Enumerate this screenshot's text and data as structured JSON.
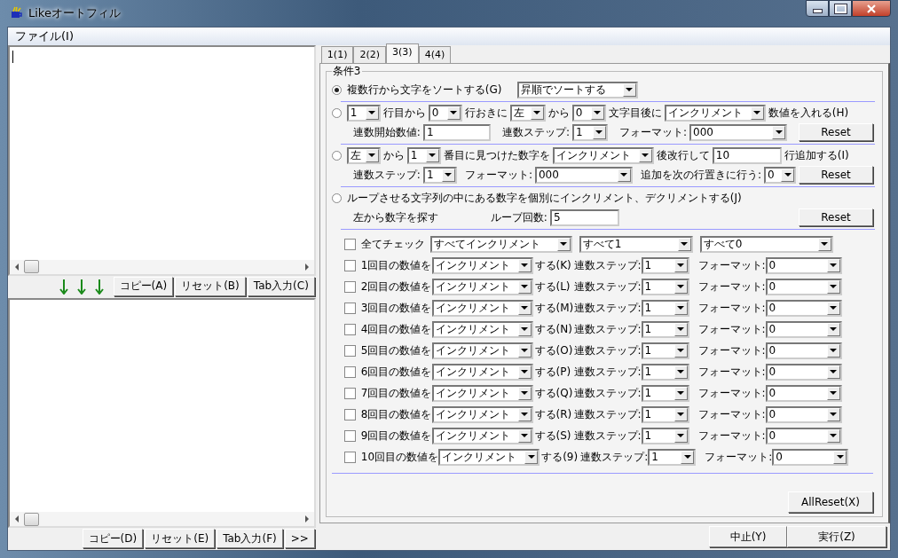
{
  "window": {
    "title": "Likeオートフィル"
  },
  "menu": [
    "ファイル(I)"
  ],
  "left": {
    "top_buttons": [
      "コピー(A)",
      "リセット(B)",
      "Tab入力(C)"
    ],
    "bottom_buttons": [
      "コピー(D)",
      "リセット(E)",
      "Tab入力(F)",
      ">>"
    ]
  },
  "tabs": [
    {
      "label": "1(1)",
      "selected": false
    },
    {
      "label": "2(2)",
      "selected": false
    },
    {
      "label": "3(3)",
      "selected": true
    },
    {
      "label": "4(4)",
      "selected": false
    }
  ],
  "group": {
    "title": "条件3",
    "options": [
      {
        "selected": true,
        "lines": [
          [
            {
              "kind": "label",
              "text": "複数行から文字をソートする(G)"
            },
            {
              "kind": "dropdown",
              "value": "昇順でソートする"
            }
          ]
        ]
      },
      {
        "selected": false,
        "lines": [
          [
            {
              "kind": "dropdown",
              "value": "1"
            },
            {
              "kind": "label",
              "text": "行目から"
            },
            {
              "kind": "dropdown",
              "value": "0"
            },
            {
              "kind": "label",
              "text": "行おきに"
            },
            {
              "kind": "dropdown",
              "value": "左"
            },
            {
              "kind": "label",
              "text": "から"
            },
            {
              "kind": "dropdown",
              "value": "0"
            },
            {
              "kind": "label",
              "text": "文字目後に"
            },
            {
              "kind": "dropdown",
              "value": "インクリメント"
            },
            {
              "kind": "label",
              "text": "数値を入れる(H)"
            }
          ],
          [
            {
              "kind": "label",
              "text": "連数開始数値:"
            },
            {
              "kind": "input",
              "value": "1"
            },
            {
              "kind": "label",
              "text": "連数ステップ:"
            },
            {
              "kind": "dropdown",
              "value": "1"
            },
            {
              "kind": "label",
              "text": "フォーマット:"
            },
            {
              "kind": "dropdown",
              "value": "000"
            },
            {
              "kind": "button",
              "text": "Reset"
            }
          ]
        ]
      },
      {
        "selected": false,
        "lines": [
          [
            {
              "kind": "dropdown",
              "value": "左"
            },
            {
              "kind": "label",
              "text": "から"
            },
            {
              "kind": "dropdown",
              "value": "1"
            },
            {
              "kind": "label",
              "text": "番目に見つけた数字を"
            },
            {
              "kind": "dropdown",
              "value": "インクリメント"
            },
            {
              "kind": "label",
              "text": "後改行して"
            },
            {
              "kind": "input",
              "value": "10"
            },
            {
              "kind": "label",
              "text": "行追加する(I)"
            }
          ],
          [
            {
              "kind": "label",
              "text": "連数ステップ:"
            },
            {
              "kind": "dropdown",
              "value": "1"
            },
            {
              "kind": "label",
              "text": "フォーマット:"
            },
            {
              "kind": "dropdown",
              "value": "000"
            },
            {
              "kind": "label",
              "text": "追加を次の行置きに行う:"
            },
            {
              "kind": "dropdown",
              "value": "0"
            },
            {
              "kind": "button",
              "text": "Reset"
            }
          ]
        ]
      },
      {
        "selected": false,
        "lines": [
          [
            {
              "kind": "label",
              "text": "ループさせる文字列の中にある数字を個別にインクリメント、デクリメントする(J)"
            }
          ],
          [
            {
              "kind": "label",
              "text": "左から数字を探す"
            },
            {
              "kind": "label",
              "text": "ループ回数:"
            },
            {
              "kind": "input",
              "value": "5"
            },
            {
              "kind": "button",
              "text": "Reset"
            }
          ]
        ]
      }
    ],
    "all_check": {
      "checked": false,
      "label": "全てチェック",
      "dropdowns": [
        "すべてインクリメント",
        "すべて1",
        "すべて0"
      ]
    },
    "rows": [
      {
        "checked": false,
        "label": "1回目の数値を",
        "mode": "インクリメント",
        "suffix": "する(K)",
        "step_label": "連数ステップ:",
        "step": "1",
        "format_label": "フォーマット:",
        "format": "0"
      },
      {
        "checked": false,
        "label": "2回目の数値を",
        "mode": "インクリメント",
        "suffix": "する(L)",
        "step_label": "連数ステップ:",
        "step": "1",
        "format_label": "フォーマット:",
        "format": "0"
      },
      {
        "checked": false,
        "label": "3回目の数値を",
        "mode": "インクリメント",
        "suffix": "する(M)",
        "step_label": "連数ステップ:",
        "step": "1",
        "format_label": "フォーマット:",
        "format": "0"
      },
      {
        "checked": false,
        "label": "4回目の数値を",
        "mode": "インクリメント",
        "suffix": "する(N)",
        "step_label": "連数ステップ:",
        "step": "1",
        "format_label": "フォーマット:",
        "format": "0"
      },
      {
        "checked": false,
        "label": "5回目の数値を",
        "mode": "インクリメント",
        "suffix": "する(O)",
        "step_label": "連数ステップ:",
        "step": "1",
        "format_label": "フォーマット:",
        "format": "0"
      },
      {
        "checked": false,
        "label": "6回目の数値を",
        "mode": "インクリメント",
        "suffix": "する(P)",
        "step_label": "連数ステップ:",
        "step": "1",
        "format_label": "フォーマット:",
        "format": "0"
      },
      {
        "checked": false,
        "label": "7回目の数値を",
        "mode": "インクリメント",
        "suffix": "する(Q)",
        "step_label": "連数ステップ:",
        "step": "1",
        "format_label": "フォーマット:",
        "format": "0"
      },
      {
        "checked": false,
        "label": "8回目の数値を",
        "mode": "インクリメント",
        "suffix": "する(R)",
        "step_label": "連数ステップ:",
        "step": "1",
        "format_label": "フォーマット:",
        "format": "0"
      },
      {
        "checked": false,
        "label": "9回目の数値を",
        "mode": "インクリメント",
        "suffix": "する(S)",
        "step_label": "連数ステップ:",
        "step": "1",
        "format_label": "フォーマット:",
        "format": "0"
      },
      {
        "checked": false,
        "label": "10回目の数値を",
        "mode": "インクリメント",
        "suffix": "する(9)",
        "step_label": "連数ステップ:",
        "step": "1",
        "format_label": "フォーマット:",
        "format": "0"
      }
    ],
    "all_reset": "AllReset(X)"
  },
  "bottom_buttons": [
    "中止(Y)",
    "実行(Z)"
  ]
}
